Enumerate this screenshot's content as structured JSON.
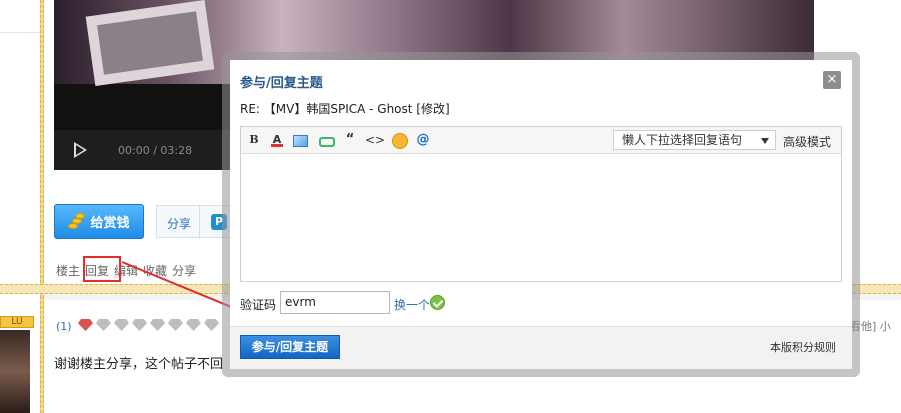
{
  "video": {
    "time": "00:00 / 03:28"
  },
  "post": {
    "reward_label": "给赏钱",
    "share_label": "分享",
    "share_icon_glyph": "P",
    "actions": [
      "楼主",
      "回复",
      "编辑",
      "收藏",
      "分享"
    ]
  },
  "next_post": {
    "level_badge": "LU",
    "floor": "(1)",
    "comment": "谢谢楼主分享，这个帖子不回",
    "right_fragment": "看他] 小"
  },
  "modal": {
    "title": "参与/回复主题",
    "close_glyph": "×",
    "subject": "RE: 【MV】韩国SPICA - Ghost [修改]",
    "toolbar": {
      "bold": "B",
      "color": "A",
      "quote": "“",
      "code": "<>",
      "at": "@",
      "quick_reply_placeholder": "懒人下拉选择回复语句",
      "advanced_mode": "高级模式"
    },
    "captcha_label": "验证码",
    "captcha_value": "evrm",
    "captcha_change": "换一个",
    "submit_label": "参与/回复主题",
    "rules_link": "本版积分规则"
  },
  "colors": {
    "accent": "#2a5a8c",
    "highlight": "#e32d2d",
    "button": "#1e7ad8"
  }
}
